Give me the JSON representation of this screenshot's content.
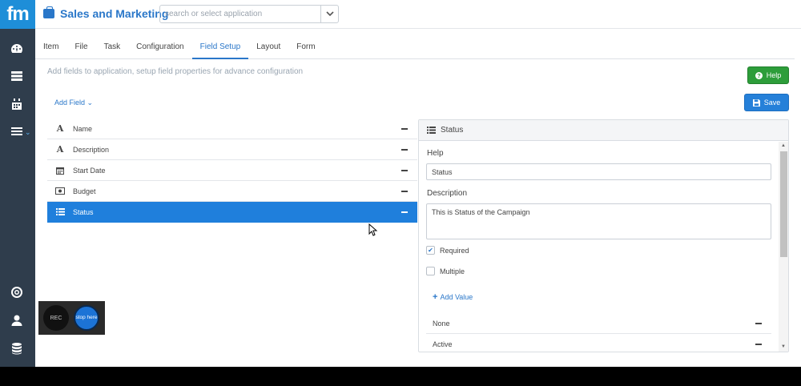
{
  "app": {
    "logo": "fm",
    "title": "Sales and Marketing"
  },
  "search": {
    "placeholder": "search or select application"
  },
  "tabs": [
    {
      "label": "Item"
    },
    {
      "label": "File"
    },
    {
      "label": "Task"
    },
    {
      "label": "Configuration"
    },
    {
      "label": "Field Setup",
      "active": true
    },
    {
      "label": "Layout"
    },
    {
      "label": "Form"
    }
  ],
  "subtitle": "Add fields to application, setup field properties for advance configuration",
  "buttons": {
    "help": "Help",
    "save": "Save",
    "add_field": "Add Field"
  },
  "fields": [
    {
      "label": "Name",
      "icon": "text-icon"
    },
    {
      "label": "Description",
      "icon": "text-icon"
    },
    {
      "label": "Start Date",
      "icon": "calendar-icon"
    },
    {
      "label": "Budget",
      "icon": "money-icon"
    },
    {
      "label": "Status",
      "icon": "list-icon",
      "selected": true
    }
  ],
  "panel": {
    "title": "Status",
    "help_label": "Help",
    "help_value": "Status",
    "description_label": "Description",
    "description_value": "This is Status of the Campaign",
    "required_label": "Required",
    "required_checked": true,
    "multiple_label": "Multiple",
    "multiple_checked": false,
    "add_value": "Add Value",
    "values": [
      "None",
      "Active"
    ]
  },
  "recorder": {
    "rec": "REC",
    "stop": "stop here"
  },
  "colors": {
    "accent": "#2a77c9",
    "selected": "#1f7fdc",
    "help": "#2d9d3a",
    "rail": "#2f3d4c"
  }
}
